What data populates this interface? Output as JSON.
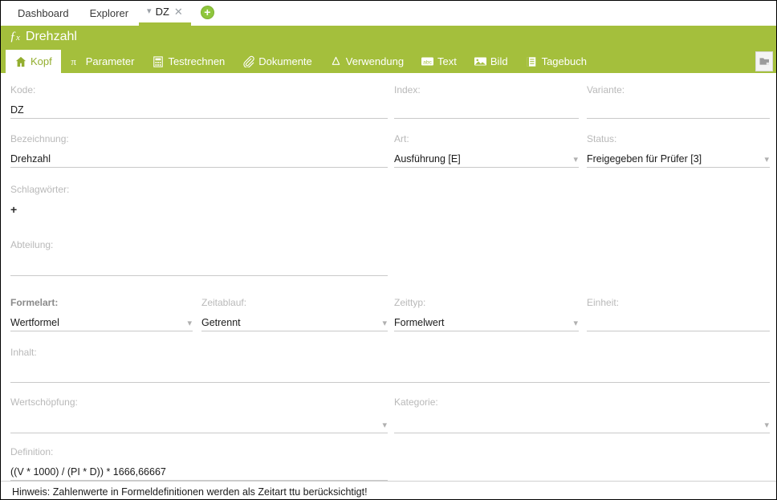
{
  "window_tabs": [
    {
      "label": "Dashboard",
      "active": false,
      "closable": false
    },
    {
      "label": "Explorer",
      "active": false,
      "closable": false
    },
    {
      "label": "DZ",
      "active": true,
      "closable": true
    }
  ],
  "add_tab_button": "+",
  "header": {
    "icon": "fx-icon",
    "title": "Drehzahl",
    "background": "#a4bf3c"
  },
  "sub_tabs": [
    {
      "label": "Kopf",
      "icon": "home-icon",
      "active": true
    },
    {
      "label": "Parameter",
      "icon": "pi-icon",
      "active": false
    },
    {
      "label": "Testrechnen",
      "icon": "calculator-icon",
      "active": false
    },
    {
      "label": "Dokumente",
      "icon": "paperclip-icon",
      "active": false
    },
    {
      "label": "Verwendung",
      "icon": "recycle-icon",
      "active": false
    },
    {
      "label": "Text",
      "icon": "abc-icon",
      "active": false
    },
    {
      "label": "Bild",
      "icon": "image-icon",
      "active": false
    },
    {
      "label": "Tagebuch",
      "icon": "journal-icon",
      "active": false
    }
  ],
  "panel_toggle_icon": "panel-folder-icon",
  "fields": {
    "kode": {
      "label": "Kode:",
      "value": "DZ",
      "type": "text",
      "required": false
    },
    "index": {
      "label": "Index:",
      "value": "",
      "type": "text",
      "required": false
    },
    "variante": {
      "label": "Variante:",
      "value": "",
      "type": "text",
      "required": false
    },
    "bezeichnung": {
      "label": "Bezeichnung:",
      "value": "Drehzahl",
      "type": "text",
      "required": false
    },
    "art": {
      "label": "Art:",
      "value": "Ausführung [E]",
      "type": "dropdown",
      "required": false
    },
    "status": {
      "label": "Status:",
      "value": "Freigegeben für Prüfer [3]",
      "type": "dropdown",
      "required": false
    },
    "schlagwoerter": {
      "label": "Schlagwörter:",
      "value": "+",
      "type": "tags",
      "required": false
    },
    "abteilung": {
      "label": "Abteilung:",
      "value": "",
      "type": "text",
      "required": false
    },
    "formelart": {
      "label": "Formelart:",
      "value": "Wertformel",
      "type": "dropdown",
      "required": true
    },
    "zeitablauf": {
      "label": "Zeitablauf:",
      "value": "Getrennt",
      "type": "dropdown",
      "required": false
    },
    "zeittyp": {
      "label": "Zeittyp:",
      "value": "Formelwert",
      "type": "dropdown",
      "required": false
    },
    "einheit": {
      "label": "Einheit:",
      "value": "",
      "type": "text",
      "required": false
    },
    "inhalt": {
      "label": "Inhalt:",
      "value": "",
      "type": "text",
      "required": false
    },
    "wertschoepfung": {
      "label": "Wertschöpfung:",
      "value": "",
      "type": "dropdown",
      "required": false
    },
    "kategorie": {
      "label": "Kategorie:",
      "value": "",
      "type": "dropdown",
      "required": false
    },
    "definition": {
      "label": "Definition:",
      "value": "((V * 1000) / (PI * D)) * 1666,66667",
      "type": "text",
      "required": false
    }
  },
  "hint": "Hinweis: Zahlenwerte in Formeldefinitionen werden als Zeitart ttu berücksichtigt!",
  "colors": {
    "brand_green": "#a4bf3c",
    "add_green": "#8fc63d",
    "label_gray": "#b9b9b9",
    "underline": "#c9c9c9"
  }
}
